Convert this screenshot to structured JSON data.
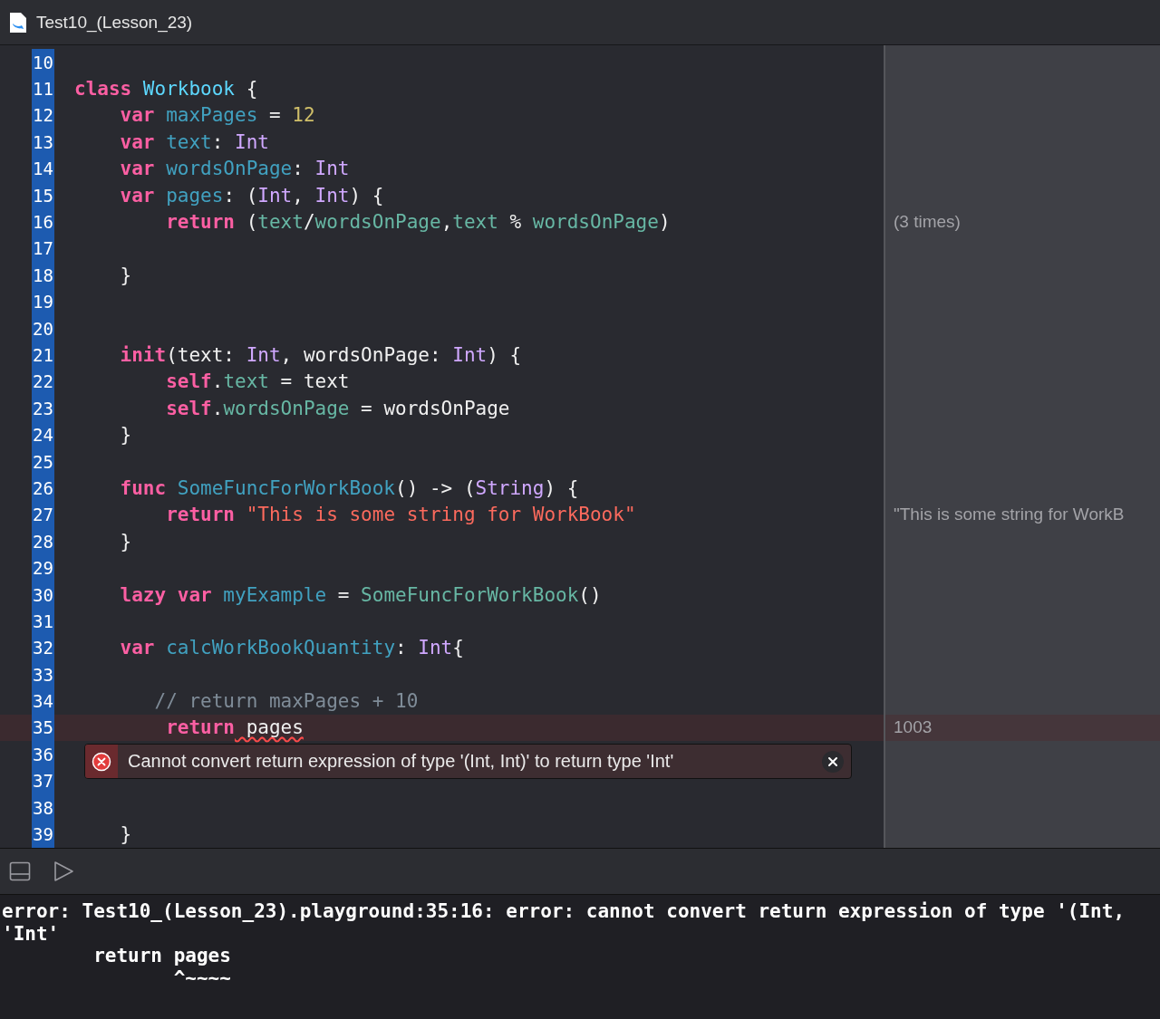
{
  "window": {
    "title": "Test10_(Lesson_23)"
  },
  "editor": {
    "lines": [
      {
        "number": "10",
        "error": false
      },
      {
        "number": "11",
        "error": false,
        "tokens": [
          {
            "kind": "kw",
            "text": "class"
          },
          {
            "kind": "typedecl",
            "text": " Workbook"
          },
          {
            "kind": "plain",
            "text": " {"
          }
        ]
      },
      {
        "number": "12",
        "error": false,
        "tokens": [
          {
            "kind": "kw",
            "text": "    var"
          },
          {
            "kind": "decl",
            "text": " maxPages"
          },
          {
            "kind": "plain",
            "text": " = "
          },
          {
            "kind": "num",
            "text": "12"
          }
        ]
      },
      {
        "number": "13",
        "error": false,
        "tokens": [
          {
            "kind": "kw",
            "text": "    var"
          },
          {
            "kind": "decl",
            "text": " text"
          },
          {
            "kind": "plain",
            "text": ": "
          },
          {
            "kind": "type",
            "text": "Int"
          }
        ]
      },
      {
        "number": "14",
        "error": false,
        "tokens": [
          {
            "kind": "kw",
            "text": "    var"
          },
          {
            "kind": "decl",
            "text": " wordsOnPage"
          },
          {
            "kind": "plain",
            "text": ": "
          },
          {
            "kind": "type",
            "text": "Int"
          }
        ]
      },
      {
        "number": "15",
        "error": false,
        "tokens": [
          {
            "kind": "kw",
            "text": "    var"
          },
          {
            "kind": "decl",
            "text": " pages"
          },
          {
            "kind": "plain",
            "text": ": ("
          },
          {
            "kind": "type",
            "text": "Int"
          },
          {
            "kind": "plain",
            "text": ", "
          },
          {
            "kind": "type",
            "text": "Int"
          },
          {
            "kind": "plain",
            "text": ") {"
          }
        ]
      },
      {
        "number": "16",
        "error": false,
        "result": "(3 times)",
        "tokens": [
          {
            "kind": "kw",
            "text": "        return"
          },
          {
            "kind": "plain",
            "text": " ("
          },
          {
            "kind": "ref",
            "text": "text"
          },
          {
            "kind": "plain",
            "text": "/"
          },
          {
            "kind": "ref",
            "text": "wordsOnPage"
          },
          {
            "kind": "plain",
            "text": ","
          },
          {
            "kind": "ref",
            "text": "text"
          },
          {
            "kind": "plain",
            "text": " % "
          },
          {
            "kind": "ref",
            "text": "wordsOnPage"
          },
          {
            "kind": "plain",
            "text": ")"
          }
        ]
      },
      {
        "number": "17",
        "error": false
      },
      {
        "number": "18",
        "error": false,
        "tokens": [
          {
            "kind": "plain",
            "text": "    }"
          }
        ]
      },
      {
        "number": "19",
        "error": false
      },
      {
        "number": "20",
        "error": false
      },
      {
        "number": "21",
        "error": false,
        "tokens": [
          {
            "kind": "kw",
            "text": "    init"
          },
          {
            "kind": "plain",
            "text": "(text: "
          },
          {
            "kind": "type",
            "text": "Int"
          },
          {
            "kind": "plain",
            "text": ", wordsOnPage: "
          },
          {
            "kind": "type",
            "text": "Int"
          },
          {
            "kind": "plain",
            "text": ") {"
          }
        ]
      },
      {
        "number": "22",
        "error": false,
        "tokens": [
          {
            "kind": "kw",
            "text": "        self"
          },
          {
            "kind": "plain",
            "text": "."
          },
          {
            "kind": "ref",
            "text": "text"
          },
          {
            "kind": "plain",
            "text": " = text"
          }
        ]
      },
      {
        "number": "23",
        "error": false,
        "tokens": [
          {
            "kind": "kw",
            "text": "        self"
          },
          {
            "kind": "plain",
            "text": "."
          },
          {
            "kind": "ref",
            "text": "wordsOnPage"
          },
          {
            "kind": "plain",
            "text": " = wordsOnPage"
          }
        ]
      },
      {
        "number": "24",
        "error": false,
        "tokens": [
          {
            "kind": "plain",
            "text": "    }"
          }
        ]
      },
      {
        "number": "25",
        "error": false
      },
      {
        "number": "26",
        "error": false,
        "tokens": [
          {
            "kind": "kw",
            "text": "    func"
          },
          {
            "kind": "decl",
            "text": " SomeFuncForWorkBook"
          },
          {
            "kind": "plain",
            "text": "() -> ("
          },
          {
            "kind": "type",
            "text": "String"
          },
          {
            "kind": "plain",
            "text": ") {"
          }
        ]
      },
      {
        "number": "27",
        "error": false,
        "result": "\"This is some string for WorkB",
        "tokens": [
          {
            "kind": "kw",
            "text": "        return"
          },
          {
            "kind": "str",
            "text": " \"This is some string for WorkBook\""
          }
        ]
      },
      {
        "number": "28",
        "error": false,
        "tokens": [
          {
            "kind": "plain",
            "text": "    }"
          }
        ]
      },
      {
        "number": "29",
        "error": false
      },
      {
        "number": "30",
        "error": false,
        "tokens": [
          {
            "kind": "kw",
            "text": "    lazy var"
          },
          {
            "kind": "decl",
            "text": " myExample"
          },
          {
            "kind": "plain",
            "text": " = "
          },
          {
            "kind": "ref",
            "text": "SomeFuncForWorkBook"
          },
          {
            "kind": "plain",
            "text": "()"
          }
        ]
      },
      {
        "number": "31",
        "error": false
      },
      {
        "number": "32",
        "error": false,
        "tokens": [
          {
            "kind": "kw",
            "text": "    var"
          },
          {
            "kind": "decl",
            "text": " calcWorkBookQuantity"
          },
          {
            "kind": "plain",
            "text": ": "
          },
          {
            "kind": "type",
            "text": "Int"
          },
          {
            "kind": "plain",
            "text": "{"
          }
        ]
      },
      {
        "number": "33",
        "error": false
      },
      {
        "number": "34",
        "error": false,
        "tokens": [
          {
            "kind": "comment",
            "text": "       // return maxPages + 10"
          }
        ]
      },
      {
        "number": "35",
        "error": true,
        "result": "1003",
        "diagnostic": "Cannot convert return expression of type '(Int, Int)' to return type 'Int'",
        "tokens": [
          {
            "kind": "kw",
            "text": "        return"
          },
          {
            "kind": "err",
            "text": " pages"
          }
        ]
      },
      {
        "number": "36",
        "error": false
      },
      {
        "number": "37",
        "error": false
      },
      {
        "number": "38",
        "error": false
      },
      {
        "number": "39",
        "error": false,
        "tokens": [
          {
            "kind": "plain",
            "text": "    }"
          }
        ]
      }
    ]
  },
  "console": {
    "lines": [
      "error: Test10_(Lesson_23).playground:35:16: error: cannot convert return expression of type '(Int,",
      "'Int'",
      "        return pages",
      "               ^~~~~"
    ]
  }
}
